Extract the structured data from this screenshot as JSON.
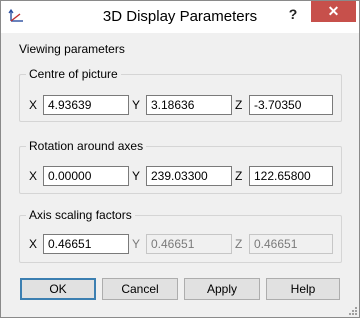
{
  "window": {
    "title": "3D Display Parameters",
    "help_label": "?",
    "close_label": "✕"
  },
  "section": {
    "viewing_label": "Viewing parameters"
  },
  "groups": {
    "centre": {
      "legend": "Centre of picture",
      "x_label": "X",
      "y_label": "Y",
      "z_label": "Z",
      "x_value": "4.93639",
      "y_value": "3.18636",
      "z_value": "-3.70350"
    },
    "rotation": {
      "legend": "Rotation around axes",
      "x_label": "X",
      "y_label": "Y",
      "z_label": "Z",
      "x_value": "0.00000",
      "y_value": "239.03300",
      "z_value": "122.65800"
    },
    "scaling": {
      "legend": "Axis scaling factors",
      "x_label": "X",
      "y_label": "Y",
      "z_label": "Z",
      "x_value": "0.46651",
      "y_value": "0.46651",
      "z_value": "0.46651"
    }
  },
  "buttons": {
    "ok": "OK",
    "cancel": "Cancel",
    "apply": "Apply",
    "help": "Help"
  },
  "icons": {
    "app": "axes-icon",
    "grip": "resize-grip-icon"
  }
}
